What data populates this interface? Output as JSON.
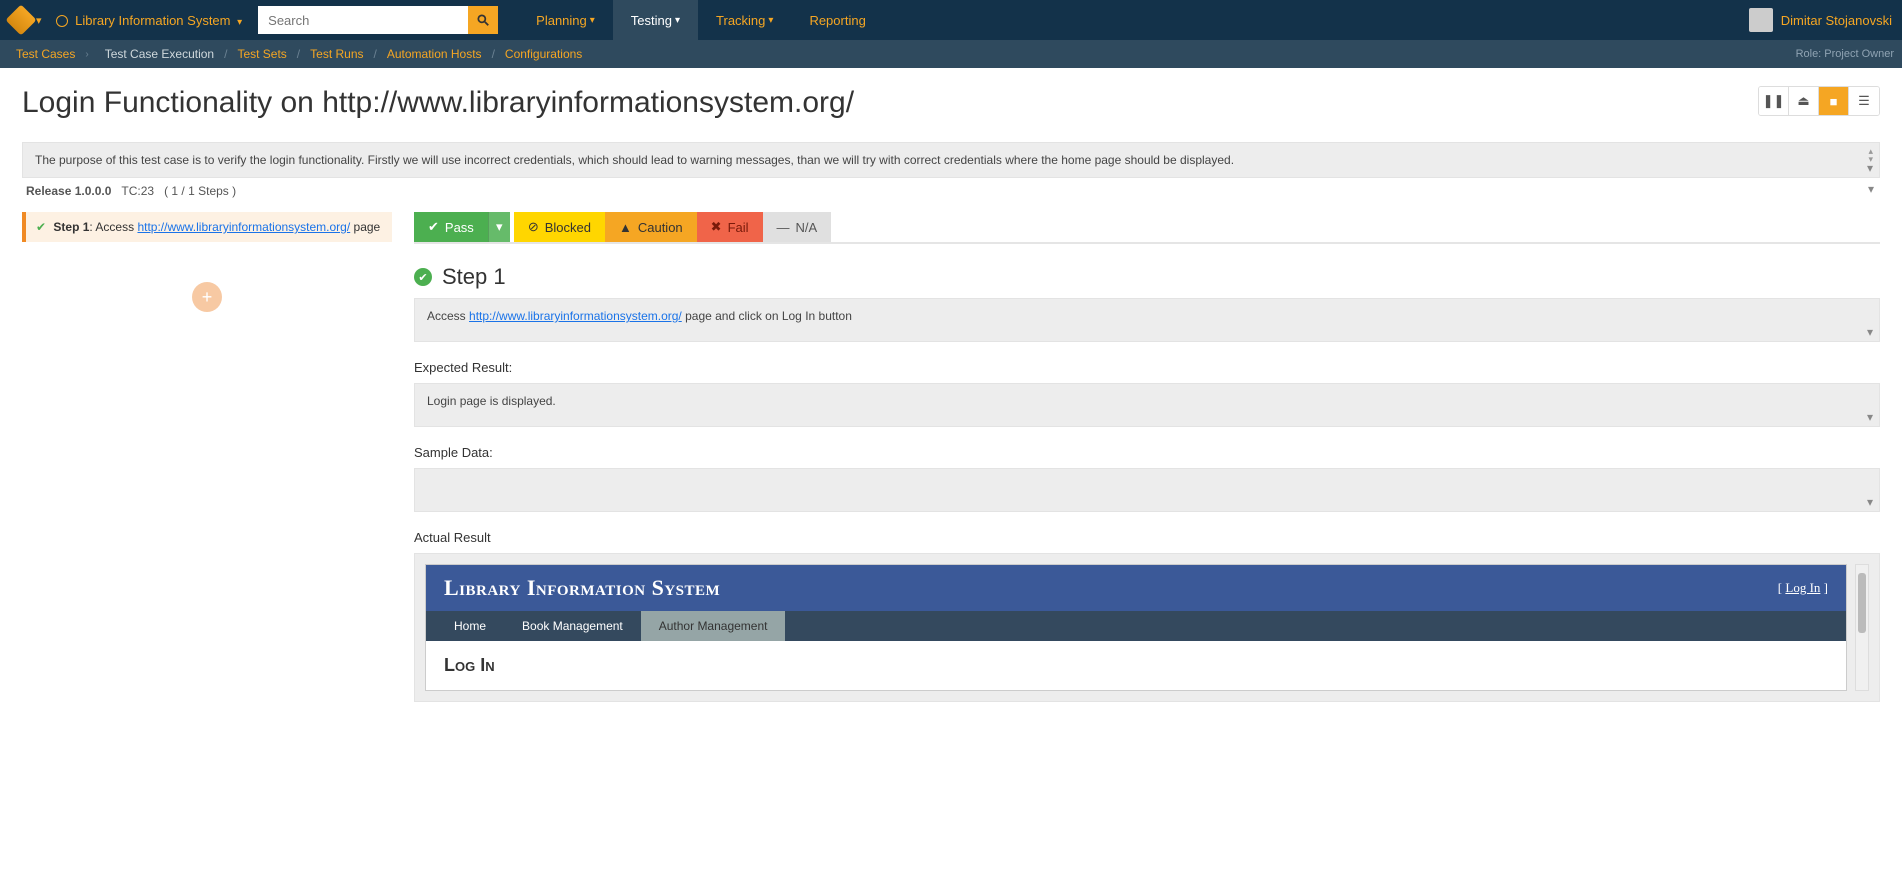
{
  "topnav": {
    "project": "Library Information System",
    "search_placeholder": "Search",
    "menu": [
      "Planning",
      "Testing",
      "Tracking",
      "Reporting"
    ],
    "active_menu": 1,
    "user": "Dimitar Stojanovski"
  },
  "subnav": {
    "items": [
      "Test Cases",
      "Test Case Execution",
      "Test Sets",
      "Test Runs",
      "Automation Hosts",
      "Configurations"
    ],
    "active_index": 1,
    "role": "Role: Project Owner"
  },
  "page_title": "Login Functionality on http://www.libraryinformationsystem.org/",
  "description": "The purpose of this test case is to verify the login functionality. Firstly we will use incorrect credentials, which should lead to warning messages, than we will try with correct credentials where the home page should be displayed.",
  "release_row": {
    "release": "Release 1.0.0.0",
    "tc": "TC:23",
    "steps": "( 1 / 1 Steps )"
  },
  "left_step": {
    "label": "Step 1",
    "prefix": ": Access ",
    "link": "http://www.libraryinformationsystem.org/",
    "suffix": " page"
  },
  "status_buttons": {
    "pass": "Pass",
    "blocked": "Blocked",
    "caution": "Caution",
    "fail": "Fail",
    "na": "N/A"
  },
  "step_detail": {
    "heading": "Step 1",
    "instruction_prefix": "Access ",
    "instruction_link": "http://www.libraryinformationsystem.org/",
    "instruction_suffix": " page and click on Log In button",
    "expected_label": "Expected Result:",
    "expected_value": "Login page is displayed.",
    "sample_label": "Sample Data:",
    "actual_label": "Actual Result"
  },
  "lib_preview": {
    "title": "Library Information System",
    "login_text": "Log In",
    "nav": [
      "Home",
      "Book Management",
      "Author Management"
    ],
    "body_heading": "Log In"
  }
}
